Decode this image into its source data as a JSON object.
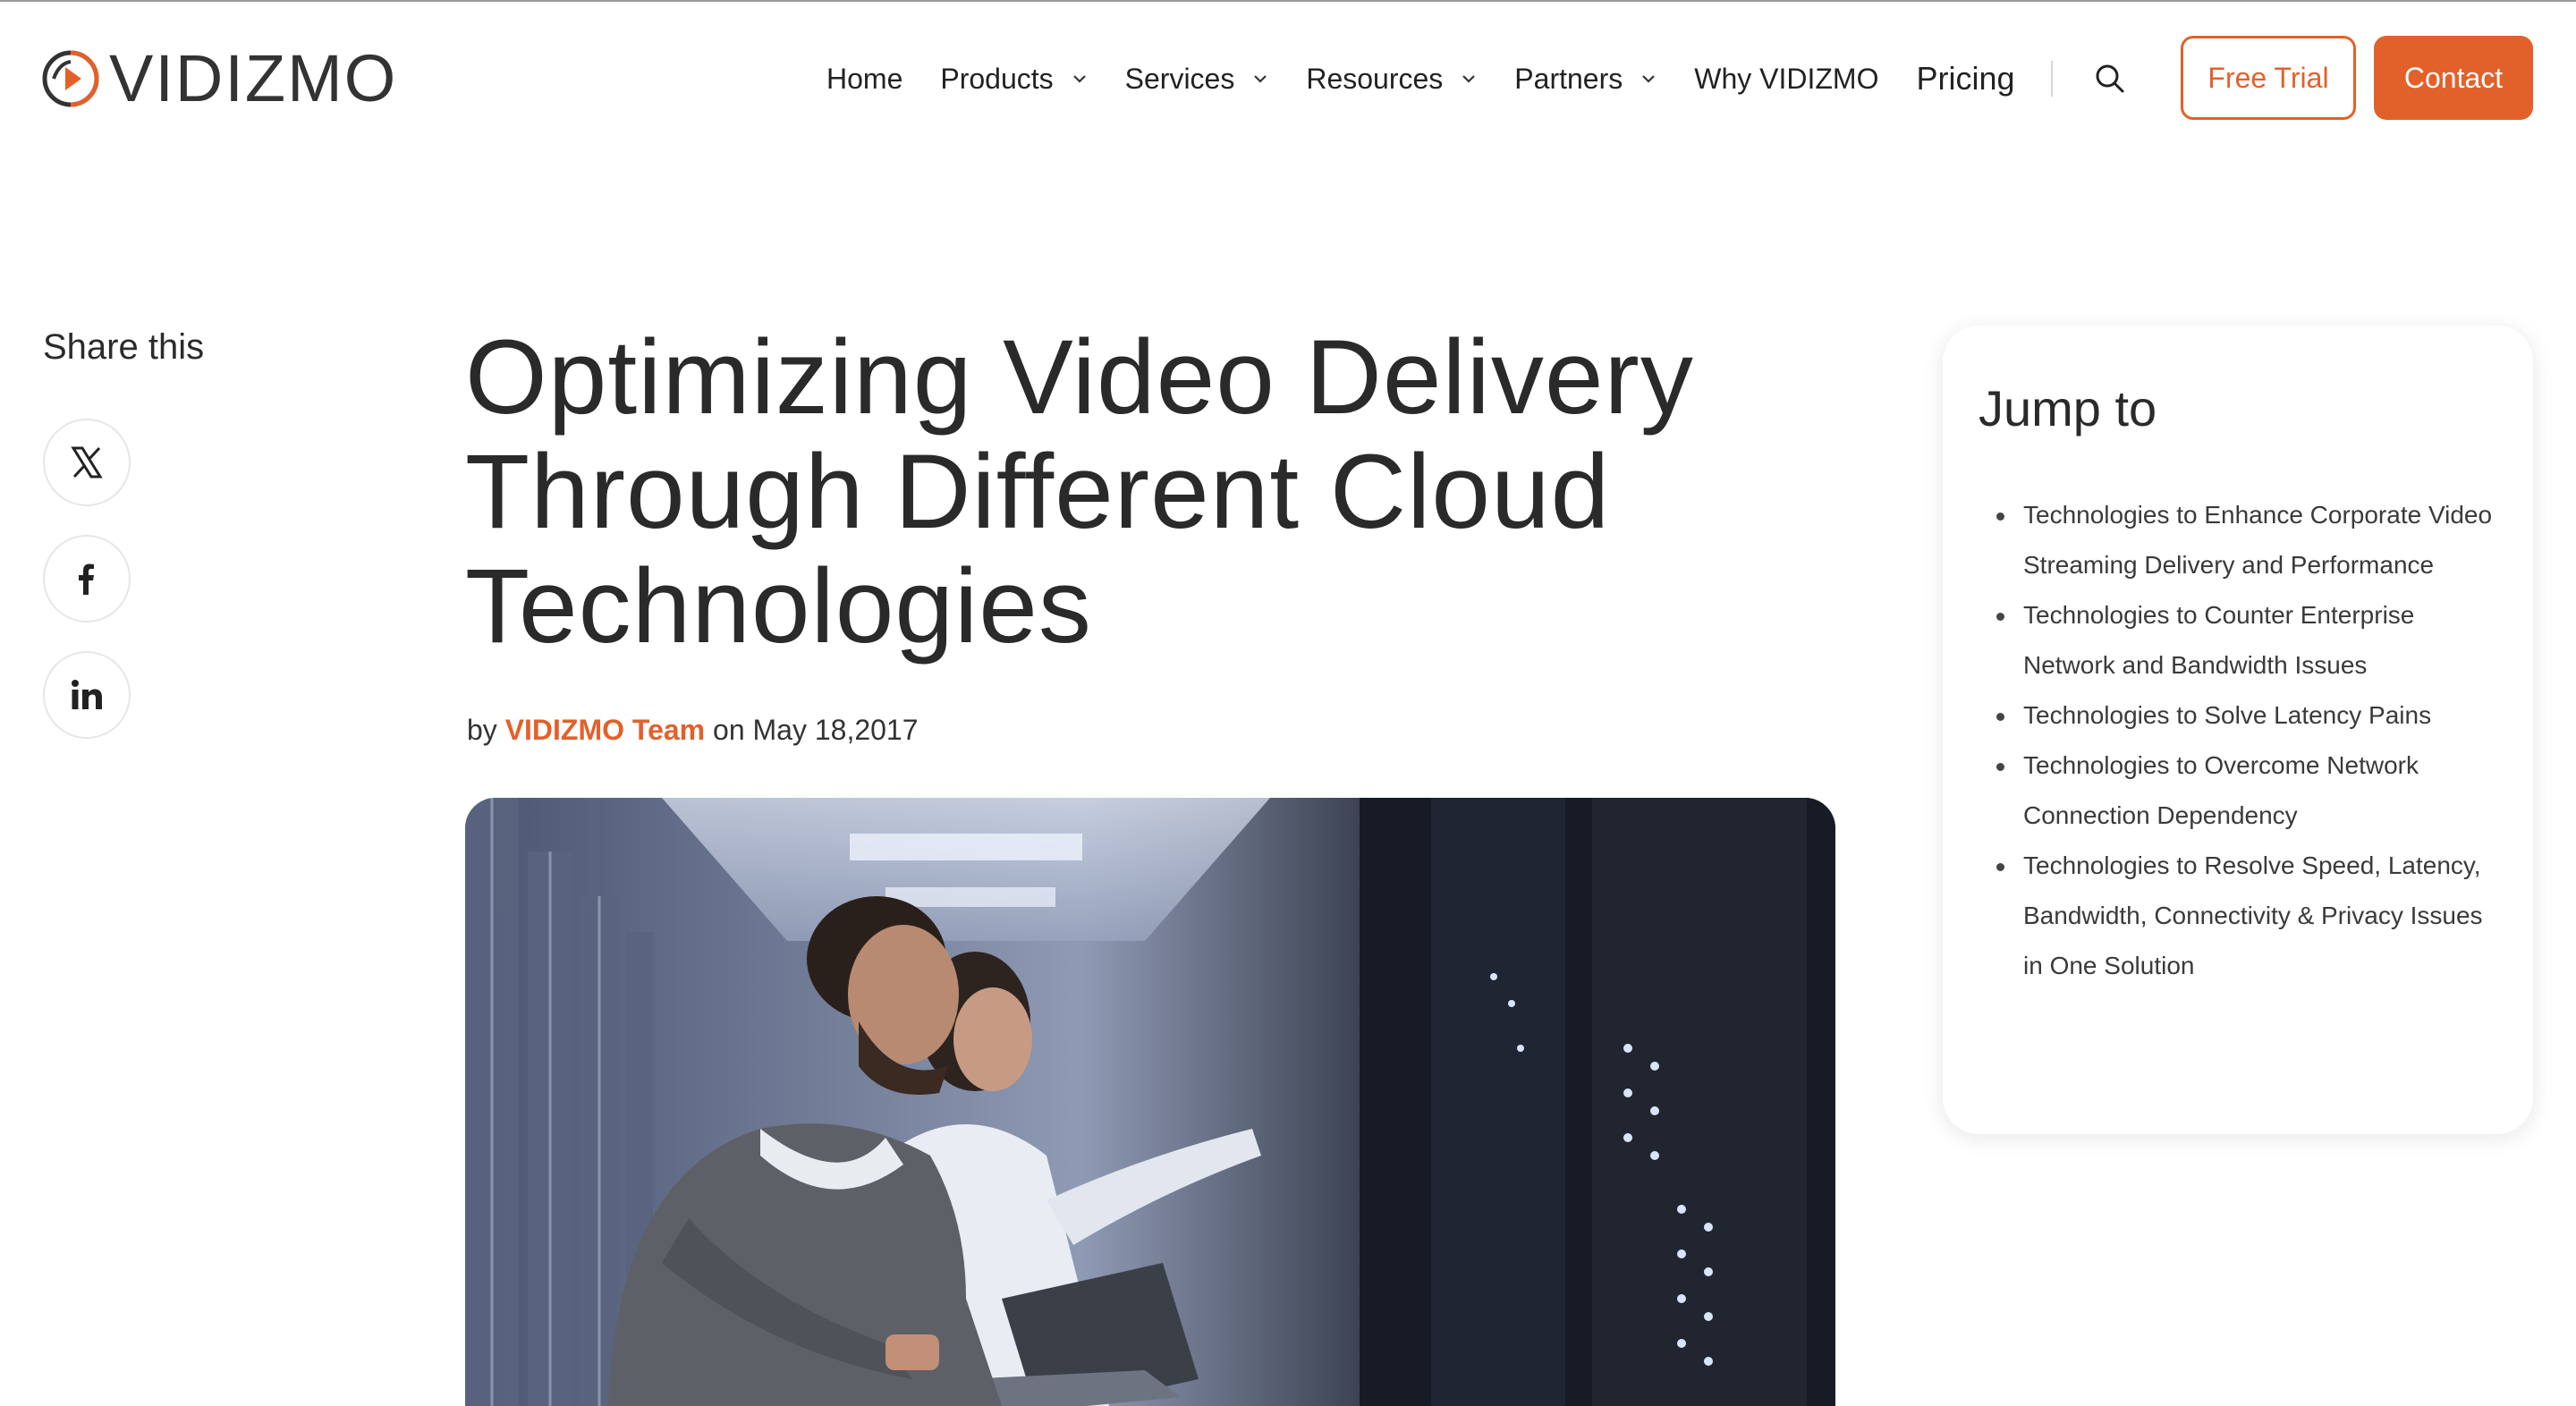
{
  "brand": {
    "name": "VIDIZMO",
    "accent": "#e2612b"
  },
  "nav": {
    "items": [
      {
        "label": "Home",
        "dropdown": false
      },
      {
        "label": "Products",
        "dropdown": true
      },
      {
        "label": "Services",
        "dropdown": true
      },
      {
        "label": "Resources",
        "dropdown": true
      },
      {
        "label": "Partners",
        "dropdown": true
      },
      {
        "label": "Why VIDIZMO",
        "dropdown": false
      },
      {
        "label": "Pricing",
        "dropdown": false
      }
    ],
    "search_icon": "search-icon",
    "free_trial_label": "Free Trial",
    "contact_label": "Contact"
  },
  "share": {
    "title": "Share this",
    "icons": [
      "x-icon",
      "facebook-icon",
      "linkedin-icon"
    ]
  },
  "article": {
    "title": "Optimizing Video Delivery Through Different Cloud Technologies",
    "by": "by",
    "author": "VIDIZMO Team",
    "on": "on",
    "date": "May 18,2017"
  },
  "jump": {
    "title": "Jump to",
    "items": [
      "Technologies to Enhance Corporate Video Streaming Delivery and Performance",
      "Technologies to Counter Enterprise Network and Bandwidth Issues",
      "Technologies to Solve Latency Pains",
      "Technologies to Overcome Network Connection Dependency",
      "Technologies to Resolve Speed, Latency, Bandwidth, Connectivity & Privacy Issues in One Solution"
    ]
  }
}
